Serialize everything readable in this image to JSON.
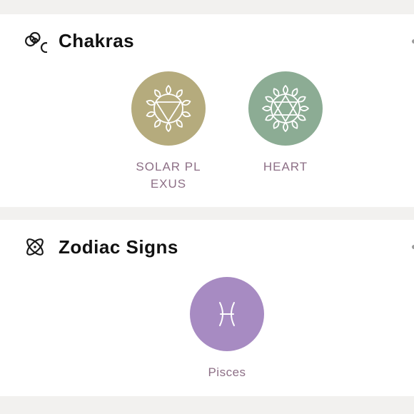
{
  "sections": {
    "chakras": {
      "title": "Chakras",
      "icon": "biohazard-icon",
      "items": [
        {
          "label": "SOLAR PL\nEXUS",
          "color": "#b5ab7d",
          "icon": "solar-plexus-chakra-icon"
        },
        {
          "label": "HEART",
          "color": "#8cac94",
          "icon": "heart-chakra-icon"
        }
      ]
    },
    "zodiac": {
      "title": "Zodiac Signs",
      "icon": "atom-icon",
      "items": [
        {
          "label": "Pisces",
          "color": "#a78bc2",
          "icon": "pisces-icon"
        }
      ]
    }
  },
  "colors": {
    "label": "#8d6f86",
    "page_background": "#f2f1ef",
    "card_background": "#ffffff"
  }
}
